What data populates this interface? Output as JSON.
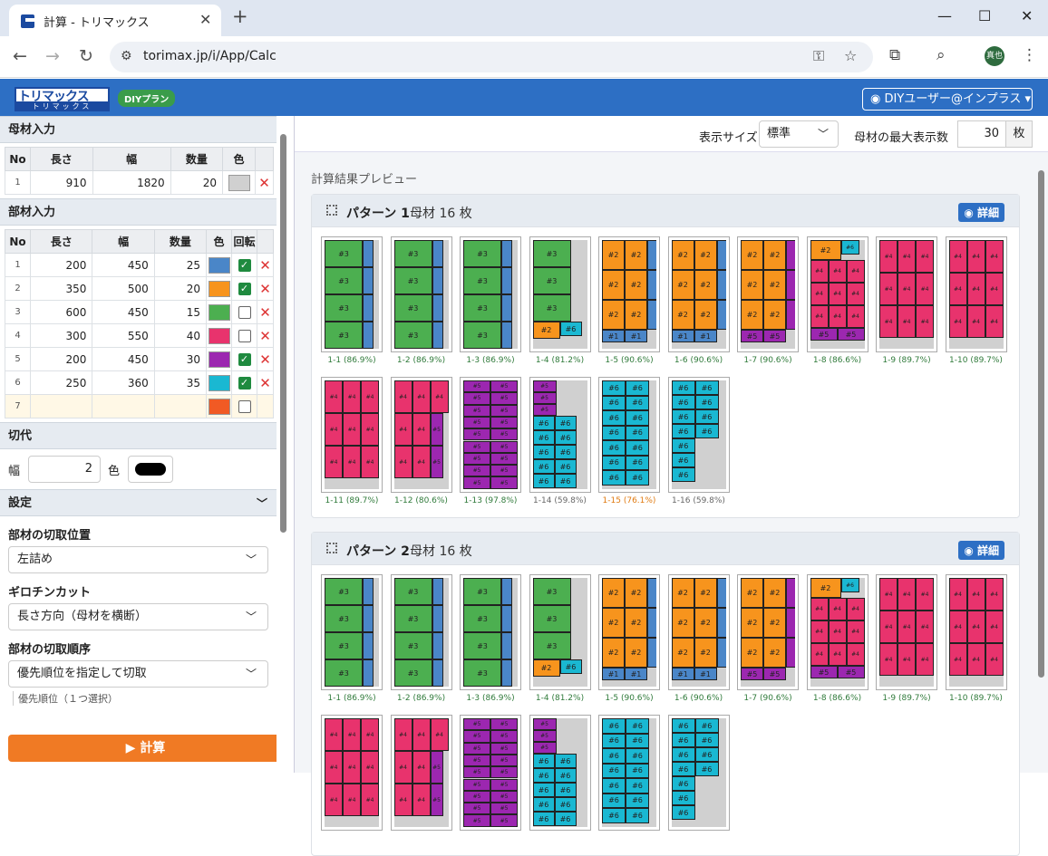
{
  "browser": {
    "tab_title": "計算 - トリマックス",
    "url": "torimax.jp/i/App/Calc",
    "profile": "真也"
  },
  "app": {
    "logo_main": "トリマックス",
    "logo_sub": "トリマックス",
    "plan_badge": "DIYプラン",
    "user_menu": "DIYユーザー@インプラス ▾"
  },
  "stock": {
    "title": "母材入力",
    "headers": [
      "No",
      "長さ",
      "幅",
      "数量",
      "色"
    ],
    "rows": [
      {
        "no": "1",
        "len": "910",
        "wid": "1820",
        "qty": "20",
        "color": "#d0d0d0"
      }
    ]
  },
  "parts": {
    "title": "部材入力",
    "headers": [
      "No",
      "長さ",
      "幅",
      "数量",
      "色",
      "回転"
    ],
    "rows": [
      {
        "no": "1",
        "len": "200",
        "wid": "450",
        "qty": "25",
        "color": "#4a86c8",
        "rot": true
      },
      {
        "no": "2",
        "len": "350",
        "wid": "500",
        "qty": "20",
        "color": "#f7941d",
        "rot": true
      },
      {
        "no": "3",
        "len": "600",
        "wid": "450",
        "qty": "15",
        "color": "#4caf50",
        "rot": false
      },
      {
        "no": "4",
        "len": "300",
        "wid": "550",
        "qty": "40",
        "color": "#e8336d",
        "rot": false
      },
      {
        "no": "5",
        "len": "200",
        "wid": "450",
        "qty": "30",
        "color": "#9c27b0",
        "rot": true
      },
      {
        "no": "6",
        "len": "250",
        "wid": "360",
        "qty": "35",
        "color": "#1ab8d2",
        "rot": true
      },
      {
        "no": "7",
        "len": "",
        "wid": "",
        "qty": "",
        "color": "#f15a24",
        "rot": false
      }
    ]
  },
  "kerf": {
    "title": "切代",
    "width_label": "幅",
    "width_value": "2",
    "color_label": "色",
    "color": "#000000"
  },
  "settings": {
    "title": "設定",
    "cut_pos_label": "部材の切取位置",
    "cut_pos_value": "左詰め",
    "guillotine_label": "ギロチンカット",
    "guillotine_value": "長さ方向（母材を横断）",
    "order_label": "部材の切取順序",
    "order_value": "優先順位を指定して切取",
    "priority_hint": "優先順位（１つ選択）"
  },
  "calc_button": "▶ 計算",
  "toolbar": {
    "size_label": "表示サイズ",
    "size_value": "標準",
    "max_label": "母材の最大表示数",
    "max_value": "30",
    "max_unit": "枚"
  },
  "preview_title": "計算結果プレビュー",
  "patterns": [
    {
      "name": "パターン 1",
      "count": "母材 16 枚",
      "detail": "詳細",
      "captions": [
        "1-1 (86.9%)",
        "1-2 (86.9%)",
        "1-3 (86.9%)",
        "1-4 (81.2%)",
        "1-5 (90.6%)",
        "1-6 (90.6%)",
        "1-7 (90.6%)",
        "1-8 (86.6%)",
        "1-9 (89.7%)",
        "1-10 (89.7%)",
        "1-11 (89.7%)",
        "1-12 (80.6%)",
        "1-13 (97.8%)",
        "1-14 (59.8%)",
        "1-15 (76.1%)",
        "1-16 (59.8%)"
      ]
    },
    {
      "name": "パターン 2",
      "count": "母材 16 枚",
      "detail": "詳細",
      "captions": [
        "1-1 (86.9%)",
        "1-2 (86.9%)",
        "1-3 (86.9%)",
        "1-4 (81.2%)",
        "1-5 (90.6%)",
        "1-6 (90.6%)",
        "1-7 (90.6%)",
        "1-8 (86.6%)",
        "1-9 (89.7%)",
        "1-10 (89.7%)"
      ]
    }
  ],
  "part_labels": {
    "p1": "#1",
    "p2": "#2",
    "p3": "#3",
    "p4": "#4",
    "p5": "#5",
    "p6": "#6"
  }
}
